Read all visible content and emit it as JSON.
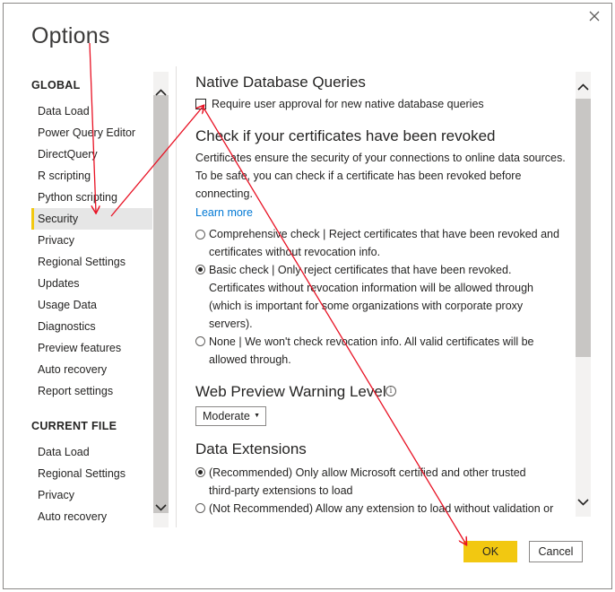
{
  "dialog": {
    "title": "Options"
  },
  "nav": {
    "global_header": "GLOBAL",
    "global_items": [
      {
        "label": "Data Load"
      },
      {
        "label": "Power Query Editor"
      },
      {
        "label": "DirectQuery"
      },
      {
        "label": "R scripting"
      },
      {
        "label": "Python scripting"
      },
      {
        "label": "Security",
        "selected": true
      },
      {
        "label": "Privacy"
      },
      {
        "label": "Regional Settings"
      },
      {
        "label": "Updates"
      },
      {
        "label": "Usage Data"
      },
      {
        "label": "Diagnostics"
      },
      {
        "label": "Preview features"
      },
      {
        "label": "Auto recovery"
      },
      {
        "label": "Report settings"
      }
    ],
    "current_header": "CURRENT FILE",
    "current_items": [
      {
        "label": "Data Load"
      },
      {
        "label": "Regional Settings"
      },
      {
        "label": "Privacy"
      },
      {
        "label": "Auto recovery"
      }
    ]
  },
  "content": {
    "native_heading": "Native Database Queries",
    "native_checkbox_label": "Require user approval for new native database queries",
    "cert_heading": "Check if your certificates have been revoked",
    "cert_desc_1": "Certificates ensure the security of your connections to online data sources.",
    "cert_desc_2": "To be safe, you can check if a certificate has been revoked before",
    "cert_desc_3": "connecting.",
    "learn_more": "Learn more",
    "revocation_options": [
      {
        "lines": [
          "Comprehensive check | Reject certificates that have been revoked and",
          "certificates without revocation info."
        ],
        "selected": false
      },
      {
        "lines": [
          "Basic check | Only reject certificates that have been revoked.",
          "Certificates without revocation information will be allowed through",
          "(which is important for some organizations with corporate proxy",
          "servers)."
        ],
        "selected": true
      },
      {
        "lines": [
          "None | We won't check revocation info. All valid certificates will be",
          "allowed through."
        ],
        "selected": false
      }
    ],
    "web_preview_heading": "Web Preview Warning Level",
    "web_preview_value": "Moderate",
    "data_ext_heading": "Data Extensions",
    "ext_options": [
      {
        "lines": [
          "(Recommended) Only allow Microsoft certified and other trusted",
          "third-party extensions to load"
        ],
        "selected": true
      },
      {
        "lines": [
          "(Not Recommended) Allow any extension to load without validation or"
        ],
        "selected": false
      }
    ]
  },
  "buttons": {
    "ok": "OK",
    "cancel": "Cancel"
  },
  "colors": {
    "accent": "#f2c811",
    "link": "#0078d4",
    "annotation": "#e81123"
  },
  "icons": {
    "close": "close-icon",
    "info": "info-icon",
    "scroll_up": "chevron-up-icon",
    "scroll_down": "chevron-down-icon",
    "dropdown": "caret-down-icon"
  }
}
